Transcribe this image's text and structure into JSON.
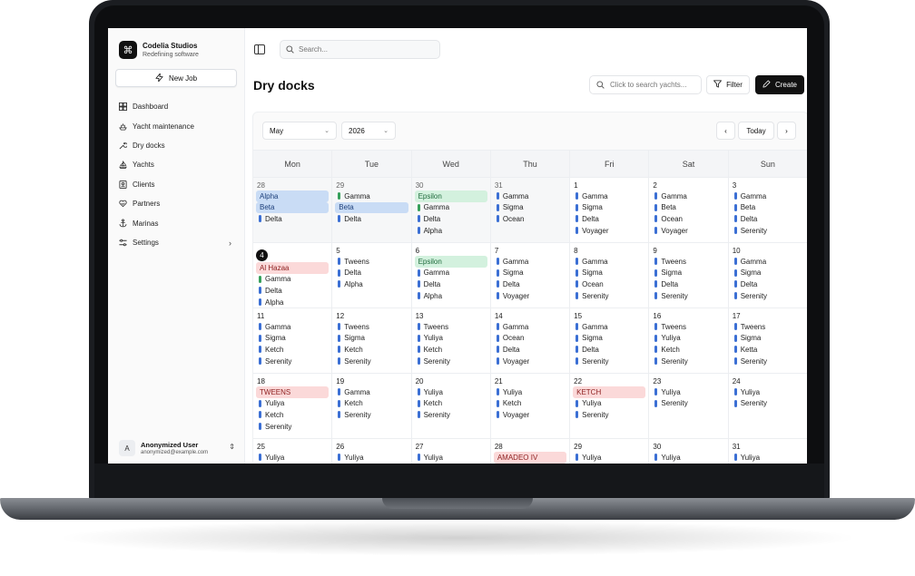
{
  "sidebar": {
    "brand_name": "Codelia Studios",
    "brand_sub": "Redefining software",
    "new_job": "New Job",
    "items": [
      {
        "label": "Dashboard",
        "icon": "grid-icon"
      },
      {
        "label": "Yacht maintenance",
        "icon": "ship-icon"
      },
      {
        "label": "Dry docks",
        "icon": "wrench-icon"
      },
      {
        "label": "Yachts",
        "icon": "sailboat-icon"
      },
      {
        "label": "Clients",
        "icon": "contact-icon"
      },
      {
        "label": "Partners",
        "icon": "handshake-icon"
      },
      {
        "label": "Marinas",
        "icon": "anchor-icon"
      },
      {
        "label": "Settings",
        "icon": "sliders-icon"
      }
    ],
    "user_initial": "A",
    "user_name": "Anonymized User",
    "user_email": "anonymized@example.com"
  },
  "topbar": {
    "search_placeholder": "Search..."
  },
  "page": {
    "title": "Dry docks",
    "search_placeholder": "Click to search yachts...",
    "filter": "Filter",
    "create": "Create"
  },
  "calendar": {
    "month": "May",
    "year": "2026",
    "today_label": "Today",
    "days": [
      "Mon",
      "Tue",
      "Wed",
      "Thu",
      "Fri",
      "Sat",
      "Sun"
    ],
    "weeks": [
      [
        {
          "d": "28",
          "out": true,
          "events": [
            {
              "t": "Alpha",
              "s": "band-blue"
            },
            {
              "t": "Beta",
              "s": "band-blue"
            },
            {
              "t": "Delta"
            }
          ]
        },
        {
          "d": "29",
          "out": true,
          "events": [
            {
              "t": "Gamma",
              "s": "green"
            },
            {
              "t": "Beta",
              "s": "band-blue"
            },
            {
              "t": "Delta"
            }
          ]
        },
        {
          "d": "30",
          "out": true,
          "events": [
            {
              "t": "Epsilon",
              "s": "band-green"
            },
            {
              "t": "Gamma",
              "s": "green"
            },
            {
              "t": "Delta"
            },
            {
              "t": "Alpha"
            }
          ]
        },
        {
          "d": "31",
          "out": true,
          "events": [
            {
              "t": "Gamma"
            },
            {
              "t": "Sigma"
            },
            {
              "t": "Ocean"
            }
          ]
        },
        {
          "d": "1",
          "events": [
            {
              "t": "Gamma"
            },
            {
              "t": "Sigma"
            },
            {
              "t": "Delta"
            },
            {
              "t": "Voyager"
            }
          ]
        },
        {
          "d": "2",
          "events": [
            {
              "t": "Gamma"
            },
            {
              "t": "Beta"
            },
            {
              "t": "Ocean"
            },
            {
              "t": "Voyager"
            }
          ]
        },
        {
          "d": "3",
          "events": [
            {
              "t": "Gamma"
            },
            {
              "t": "Beta"
            },
            {
              "t": "Delta"
            },
            {
              "t": "Serenity"
            }
          ]
        }
      ],
      [
        {
          "d": "4",
          "today": true,
          "events": [
            {
              "t": "Al Hazaa",
              "s": "band-red"
            },
            {
              "t": "Gamma",
              "s": "green"
            },
            {
              "t": "Delta"
            },
            {
              "t": "Alpha"
            }
          ]
        },
        {
          "d": "5",
          "events": [
            {
              "t": "Tweens"
            },
            {
              "t": "Delta"
            },
            {
              "t": "Alpha"
            }
          ]
        },
        {
          "d": "6",
          "events": [
            {
              "t": "Epsilon",
              "s": "band-green"
            },
            {
              "t": "Gamma"
            },
            {
              "t": "Delta"
            },
            {
              "t": "Alpha"
            }
          ]
        },
        {
          "d": "7",
          "events": [
            {
              "t": "Gamma"
            },
            {
              "t": "Sigma"
            },
            {
              "t": "Delta"
            },
            {
              "t": "Voyager"
            }
          ]
        },
        {
          "d": "8",
          "events": [
            {
              "t": "Gamma"
            },
            {
              "t": "Sigma"
            },
            {
              "t": "Ocean"
            },
            {
              "t": "Serenity"
            }
          ]
        },
        {
          "d": "9",
          "events": [
            {
              "t": "Tweens"
            },
            {
              "t": "Sigma"
            },
            {
              "t": "Delta"
            },
            {
              "t": "Serenity"
            }
          ]
        },
        {
          "d": "10",
          "events": [
            {
              "t": "Gamma"
            },
            {
              "t": "Sigma"
            },
            {
              "t": "Delta"
            },
            {
              "t": "Serenity"
            }
          ]
        }
      ],
      [
        {
          "d": "11",
          "events": [
            {
              "t": "Gamma"
            },
            {
              "t": "Sigma"
            },
            {
              "t": "Ketch"
            },
            {
              "t": "Serenity"
            }
          ]
        },
        {
          "d": "12",
          "events": [
            {
              "t": "Tweens"
            },
            {
              "t": "Sigma"
            },
            {
              "t": "Ketch"
            },
            {
              "t": "Serenity"
            }
          ]
        },
        {
          "d": "13",
          "events": [
            {
              "t": "Tweens"
            },
            {
              "t": "Yuliya"
            },
            {
              "t": "Ketch"
            },
            {
              "t": "Serenity"
            }
          ]
        },
        {
          "d": "14",
          "events": [
            {
              "t": "Gamma"
            },
            {
              "t": "Ocean"
            },
            {
              "t": "Delta"
            },
            {
              "t": "Voyager"
            }
          ]
        },
        {
          "d": "15",
          "events": [
            {
              "t": "Gamma"
            },
            {
              "t": "Sigma"
            },
            {
              "t": "Delta"
            },
            {
              "t": "Serenity"
            }
          ]
        },
        {
          "d": "16",
          "events": [
            {
              "t": "Tweens"
            },
            {
              "t": "Yuliya"
            },
            {
              "t": "Ketch"
            },
            {
              "t": "Serenity"
            }
          ]
        },
        {
          "d": "17",
          "events": [
            {
              "t": "Tweens"
            },
            {
              "t": "Sigma"
            },
            {
              "t": "Ketta"
            },
            {
              "t": "Serenity"
            }
          ]
        }
      ],
      [
        {
          "d": "18",
          "events": [
            {
              "t": "TWEENS",
              "s": "band-red"
            },
            {
              "t": "Yuliya"
            },
            {
              "t": "Ketch"
            },
            {
              "t": "Serenity"
            }
          ]
        },
        {
          "d": "19",
          "events": [
            {
              "t": "Gamma"
            },
            {
              "t": "Ketch"
            },
            {
              "t": "Serenity"
            }
          ]
        },
        {
          "d": "20",
          "events": [
            {
              "t": "Yuliya"
            },
            {
              "t": "Ketch"
            },
            {
              "t": "Serenity"
            }
          ]
        },
        {
          "d": "21",
          "events": [
            {
              "t": "Yuliya"
            },
            {
              "t": "Ketch"
            },
            {
              "t": "Voyager"
            }
          ]
        },
        {
          "d": "22",
          "events": [
            {
              "t": "KETCH",
              "s": "band-red"
            },
            {
              "t": "Yuliya"
            },
            {
              "t": "Serenity"
            }
          ]
        },
        {
          "d": "23",
          "events": [
            {
              "t": "Yuliya"
            },
            {
              "t": "Serenity"
            }
          ]
        },
        {
          "d": "24",
          "events": [
            {
              "t": "Yuliya"
            },
            {
              "t": "Serenity"
            }
          ]
        }
      ],
      [
        {
          "d": "25",
          "events": [
            {
              "t": "Yuliya"
            }
          ]
        },
        {
          "d": "26",
          "events": [
            {
              "t": "Yuliya"
            }
          ]
        },
        {
          "d": "27",
          "events": [
            {
              "t": "Yuliya"
            }
          ]
        },
        {
          "d": "28",
          "events": [
            {
              "t": "AMADEO IV",
              "s": "band-red"
            }
          ]
        },
        {
          "d": "29",
          "events": [
            {
              "t": "Yuliya"
            }
          ]
        },
        {
          "d": "30",
          "events": [
            {
              "t": "Yuliya"
            }
          ]
        },
        {
          "d": "31",
          "events": [
            {
              "t": "Yuliya"
            }
          ]
        }
      ]
    ]
  },
  "colors": {
    "accent": "#111111",
    "event_blue": "#3b6fd4",
    "event_green": "#36a05b",
    "band_red": "#fbd9d9",
    "band_blue": "#c9dcf5",
    "band_green": "#d3f1de"
  }
}
